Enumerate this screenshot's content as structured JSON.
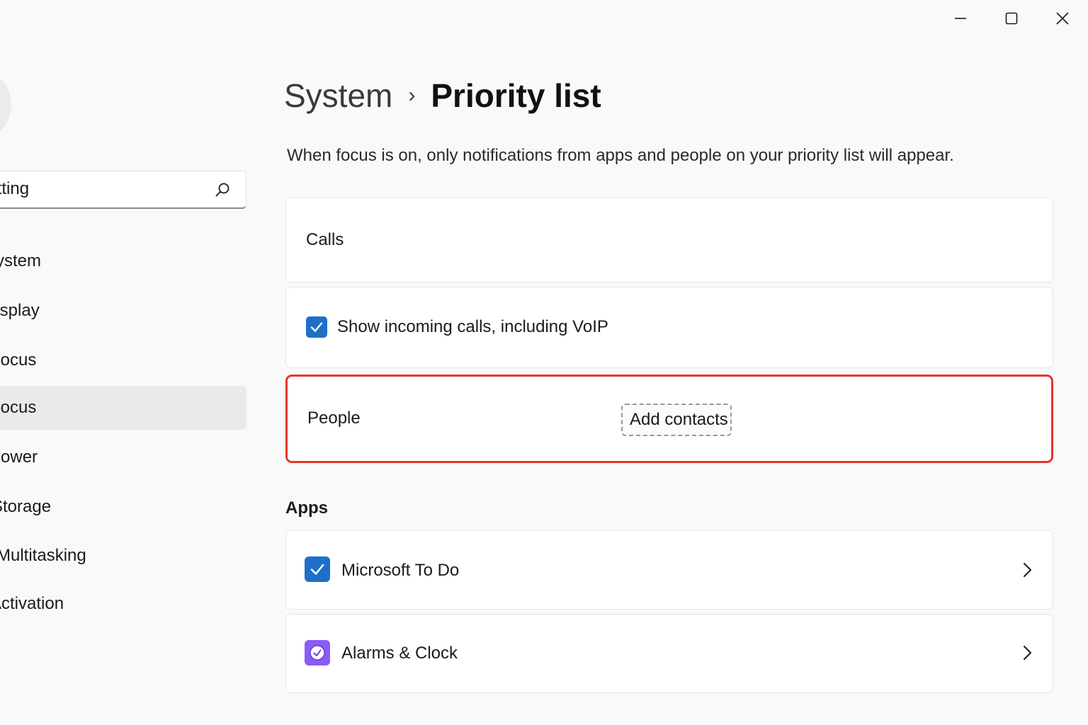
{
  "window": {
    "controls": {
      "minimize": "minimize",
      "maximize": "maximize",
      "close": "close"
    }
  },
  "sidebar": {
    "search": {
      "value": "getting"
    },
    "items": [
      {
        "label": "System",
        "selected": false
      },
      {
        "label": "Display",
        "selected": false
      },
      {
        "label": "Focus",
        "selected": false
      },
      {
        "label": "Focus",
        "selected": true
      },
      {
        "label": "Power",
        "selected": false
      },
      {
        "label": "Storage",
        "selected": false
      },
      {
        "label": "Multitasking",
        "selected": false
      },
      {
        "label": "Activation",
        "selected": false
      }
    ]
  },
  "header": {
    "breadcrumb_parent": "System",
    "breadcrumb_separator": "›",
    "title": "Priority list"
  },
  "description": "When focus is on, only notifications from apps and people on your priority list will appear.",
  "calls": {
    "title": "Calls",
    "incoming_label": "Show incoming calls, including VoIP",
    "incoming_checked": true
  },
  "people": {
    "title": "People",
    "add_button": "Add contacts"
  },
  "apps": {
    "section_title": "Apps",
    "items": [
      {
        "name": "Microsoft To Do",
        "checked": true,
        "icon": "checkbox-checked-icon"
      },
      {
        "name": "Alarms & Clock",
        "checked": false,
        "icon": "alarm-clock-icon"
      }
    ]
  },
  "colors": {
    "accent": "#1f6fc8",
    "highlight_border": "#e8352a",
    "alarms_icon": "#8b5cf6"
  }
}
